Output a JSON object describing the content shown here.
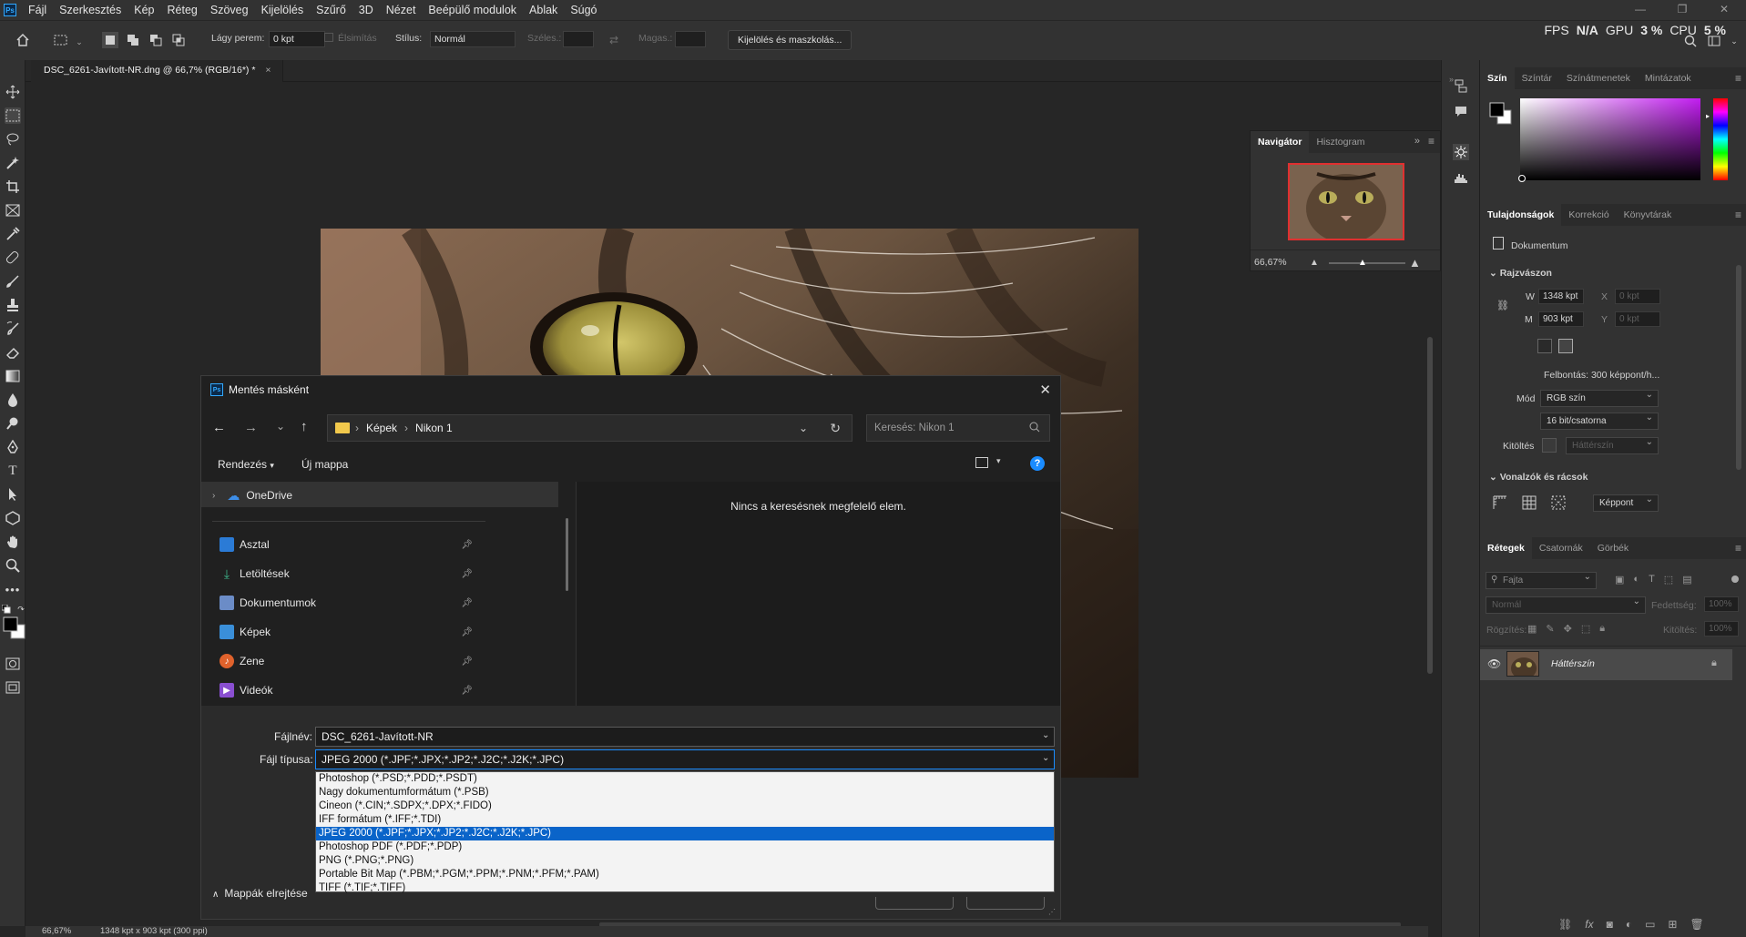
{
  "menubar": {
    "items": [
      "Fájl",
      "Szerkesztés",
      "Kép",
      "Réteg",
      "Szöveg",
      "Kijelölés",
      "Szűrő",
      "3D",
      "Nézet",
      "Beépülő modulok",
      "Ablak",
      "Súgó"
    ]
  },
  "stats": {
    "fps_label": "FPS",
    "fps_value": "N/A",
    "gpu_label": "GPU",
    "gpu_value": "3 %",
    "cpu_label": "CPU",
    "cpu_value": "5 %"
  },
  "options": {
    "feather_label": "Lágy perem:",
    "feather_value": "0 kpt",
    "smooth_label": "Élsimítás",
    "style_label": "Stílus:",
    "style_value": "Normál",
    "width_label": "Széles.:",
    "height_label": "Magas.:",
    "select_mask_button": "Kijelölés és maszkolás..."
  },
  "document": {
    "tab_title": "DSC_6261-Javított-NR.dng @ 66,7% (RGB/16*) *"
  },
  "status": {
    "zoom": "66,67%",
    "size": "1348 kpt x 903 kpt (300 ppi)"
  },
  "navigator": {
    "tabs": [
      "Navigátor",
      "Hisztogram"
    ],
    "zoom": "66,67%"
  },
  "color_panel": {
    "tabs": [
      "Szín",
      "Színtár",
      "Színátmenetek",
      "Mintázatok"
    ]
  },
  "properties": {
    "tabs": [
      "Tulajdonságok",
      "Korrekció",
      "Könyvtárak"
    ],
    "doc_label": "Dokumentum",
    "canvas_section": "Rajzvászon",
    "w_label": "W",
    "w_value": "1348 kpt",
    "h_label": "M",
    "h_value": "903 kpt",
    "x_label": "X",
    "x_value": "0 kpt",
    "y_label": "Y",
    "y_value": "0 kpt",
    "resolution": "Felbontás: 300 képpont/h...",
    "mode_label": "Mód",
    "mode_value": "RGB szín",
    "depth_value": "16 bit/csatorna",
    "fill_label": "Kitöltés",
    "fill_value": "Háttérszín",
    "guides_section": "Vonalzók és rácsok",
    "guides_value": "Képpont"
  },
  "layers": {
    "tabs": [
      "Rétegek",
      "Csatornák",
      "Görbék"
    ],
    "search_placeholder": "Fajta",
    "blend_mode": "Normál",
    "opacity_label": "Fedettség:",
    "opacity_value": "100%",
    "lock_label": "Rögzítés:",
    "fill_label": "Kitöltés:",
    "fill_value": "100%",
    "layer_name": "Háttérszín"
  },
  "dialog": {
    "title": "Mentés másként",
    "breadcrumb": [
      "Képek",
      "Nikon 1"
    ],
    "search_placeholder": "Keresés: Nikon 1",
    "organize": "Rendezés",
    "new_folder": "Új mappa",
    "empty_message": "Nincs a keresésnek megfelelő elem.",
    "nav_items": [
      "OneDrive",
      "Asztal",
      "Letöltések",
      "Dokumentumok",
      "Képek",
      "Zene",
      "Videók"
    ],
    "filename_label": "Fájlnév:",
    "filename_value": "DSC_6261-Javított-NR",
    "filetype_label": "Fájl típusa:",
    "filetype_value": "JPEG 2000 (*.JPF;*.JPX;*.JP2;*.J2C;*.J2K;*.JPC)",
    "filetypes": [
      "Photoshop (*.PSD;*.PDD;*.PSDT)",
      "Nagy dokumentumformátum (*.PSB)",
      "Cineon (*.CIN;*.SDPX;*.DPX;*.FIDO)",
      "IFF formátum (*.IFF;*.TDI)",
      "JPEG 2000 (*.JPF;*.JPX;*.JP2;*.J2C;*.J2K;*.JPC)",
      "Photoshop PDF (*.PDF;*.PDP)",
      "PNG (*.PNG;*.PNG)",
      "Portable Bit Map (*.PBM;*.PGM;*.PPM;*.PNM;*.PFM;*.PAM)",
      "TIFF (*.TIF;*.TIFF)"
    ],
    "selected_filetype_index": 4,
    "hide_folders": "Mappák elrejtése"
  },
  "colors": {
    "accent": "#0a64c9",
    "brand": "#31a8ff"
  }
}
